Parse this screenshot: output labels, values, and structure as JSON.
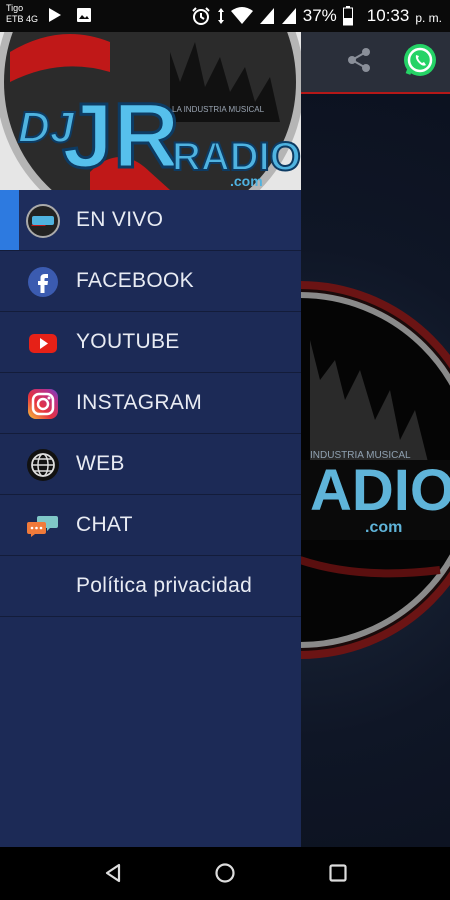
{
  "status_bar": {
    "carrier_line1": "Tigo",
    "carrier_line2": "ETB 4G",
    "battery": "37%",
    "time": "10:33",
    "ampm": "p. m."
  },
  "drawer": {
    "header_logo": {
      "brand_dj": "DJ",
      "brand_jr": "JR",
      "brand_radio": "RADIO",
      "brand_com": ".com",
      "tagline": "LA INDUSTRIA MUSICAL"
    },
    "items": [
      {
        "label": "EN VIVO",
        "icon": "radio-logo-icon",
        "active": true
      },
      {
        "label": "FACEBOOK",
        "icon": "facebook-icon"
      },
      {
        "label": "YOUTUBE",
        "icon": "youtube-icon"
      },
      {
        "label": "INSTAGRAM",
        "icon": "instagram-icon"
      },
      {
        "label": "WEB",
        "icon": "globe-icon"
      },
      {
        "label": "CHAT",
        "icon": "chat-icon"
      },
      {
        "label": "Política privacidad",
        "icon": ""
      }
    ]
  },
  "background_app": {
    "logo_radio": "ADIO",
    "logo_com": ".com",
    "logo_tagline": "INDUSTRIA MUSICAL"
  },
  "colors": {
    "drawer_bg": "#1c2a56",
    "active_indicator": "#2d7ae0",
    "toolbar_accent": "#b51818",
    "whatsapp": "#25d366"
  }
}
